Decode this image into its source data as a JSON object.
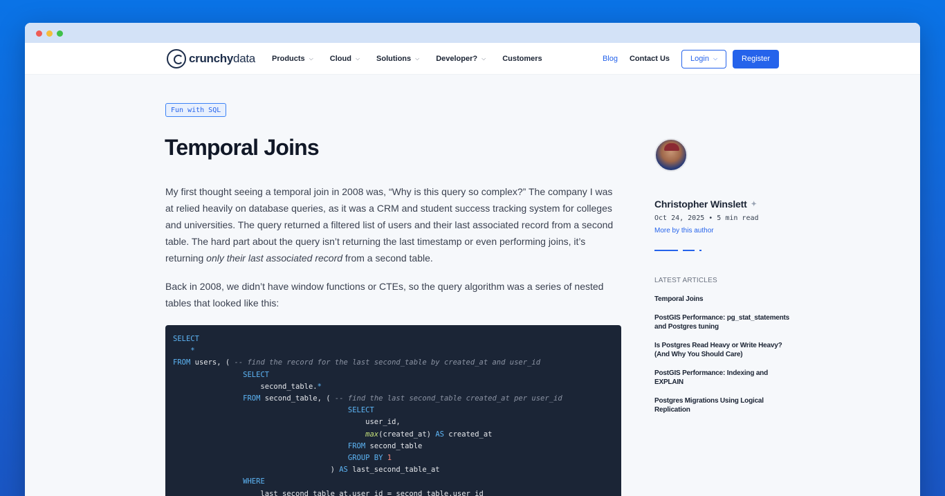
{
  "nav": {
    "logo_bold": "crunchy",
    "logo_light": "data",
    "items": [
      {
        "label": "Products",
        "has_dropdown": true
      },
      {
        "label": "Cloud",
        "has_dropdown": true
      },
      {
        "label": "Solutions",
        "has_dropdown": true
      },
      {
        "label": "Developer?",
        "has_dropdown": true
      },
      {
        "label": "Customers",
        "has_dropdown": false
      }
    ],
    "blog": "Blog",
    "contact": "Contact Us",
    "login": "Login",
    "register": "Register"
  },
  "article": {
    "tag": "Fun with SQL",
    "title": "Temporal Joins",
    "p1_part1": "My first thought seeing a temporal join in 2008 was, “Why is this query so complex?” The company I was at relied heavily on database queries, as it was a CRM and student success tracking system for colleges and universities. The query returned a filtered list of users and their last associated record from a second table. The hard part about the query isn’t returning the last timestamp or even performing joins, it’s returning ",
    "p1_em": "only their last associated record",
    "p1_part2": " from a second table.",
    "p2": "Back in 2008, we didn’t have window functions or CTEs, so the query algorithm was a series of nested tables that looked like this:"
  },
  "sidebar": {
    "author_name": "Christopher Winslett",
    "meta": "Oct 24, 2025 • 5 min read",
    "more_link": "More by this author",
    "latest_heading": "LATEST ARTICLES",
    "latest": [
      "Temporal Joins",
      "PostGIS Performance: pg_stat_statements and Postgres tuning",
      "Is Postgres Read Heavy or Write Heavy? (And Why You Should Care)",
      "PostGIS Performance: Indexing and EXPLAIN",
      "Postgres Migrations Using Logical Replication"
    ]
  },
  "colors": {
    "accent": "#2563eb",
    "code_bg": "#1b2536",
    "background": "#f6f8fb"
  },
  "icons": {
    "twitter": "twitter-icon",
    "chevron": "chevron-down-icon"
  }
}
